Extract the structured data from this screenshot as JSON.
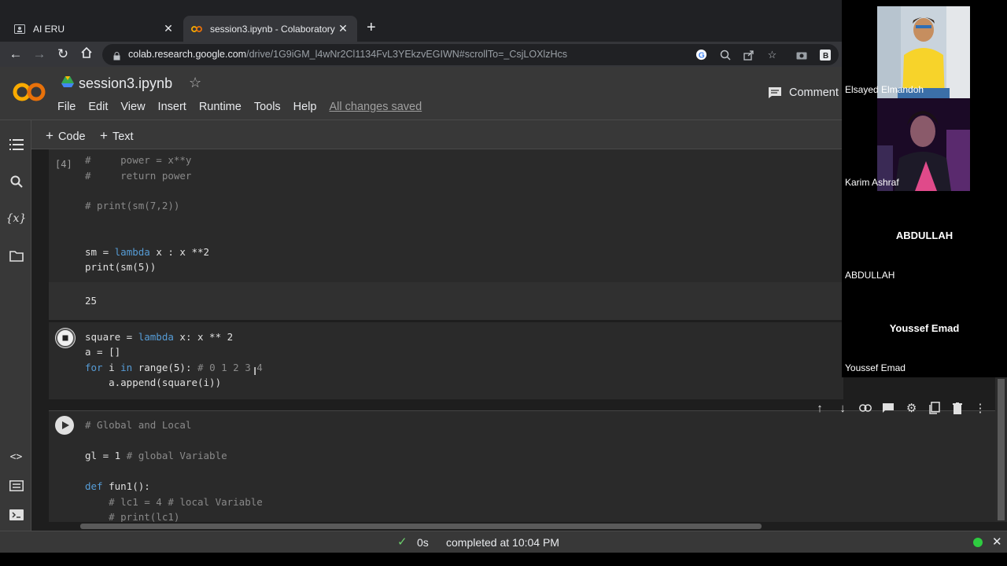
{
  "browser": {
    "tabs": [
      {
        "title": "AI ERU",
        "active": false
      },
      {
        "title": "session3.ipynb - Colaboratory",
        "active": true
      }
    ],
    "url_domain": "colab.research.google.com",
    "url_path": "/drive/1G9iGM_l4wNr2Cl1134FvL3YEkzvEGIWN#scrollTo=_CsjLOXlzHcs"
  },
  "colab": {
    "notebook_title": "session3.ipynb",
    "menu": [
      "File",
      "Edit",
      "View",
      "Insert",
      "Runtime",
      "Tools",
      "Help"
    ],
    "save_status": "All changes saved",
    "comment_label": "Comment",
    "toolbar": {
      "code_label": "Code",
      "text_label": "Text"
    }
  },
  "cells": {
    "cell1": {
      "exec_count": "[4]",
      "lines": [
        "#     power = x**y",
        "#     return power",
        "",
        "# print(sm(7,2))",
        "",
        "",
        "sm = lambda x : x **2",
        "print(sm(5))"
      ],
      "output": "25"
    },
    "cell2": {
      "lines": [
        "square = lambda x: x ** 2",
        "a = []",
        "for i in range(5): # 0 1 2 3 4",
        "    a.append(square(i))"
      ]
    },
    "cell3": {
      "lines": [
        "# Global and Local",
        "",
        "gl = 1 # global Variable",
        "",
        "def fun1():",
        "    # lc1 = 4 # local Variable",
        "    # print(lc1)"
      ]
    }
  },
  "status": {
    "duration": "0s",
    "message": "completed at 10:04 PM"
  },
  "participants": [
    {
      "name": "Elsayed Elmandoh"
    },
    {
      "name": "Karim Ashraf"
    },
    {
      "name": "ABDULLAH",
      "display": "ABDULLAH"
    },
    {
      "name": "Youssef Emad",
      "display": "Youssef Emad"
    }
  ]
}
